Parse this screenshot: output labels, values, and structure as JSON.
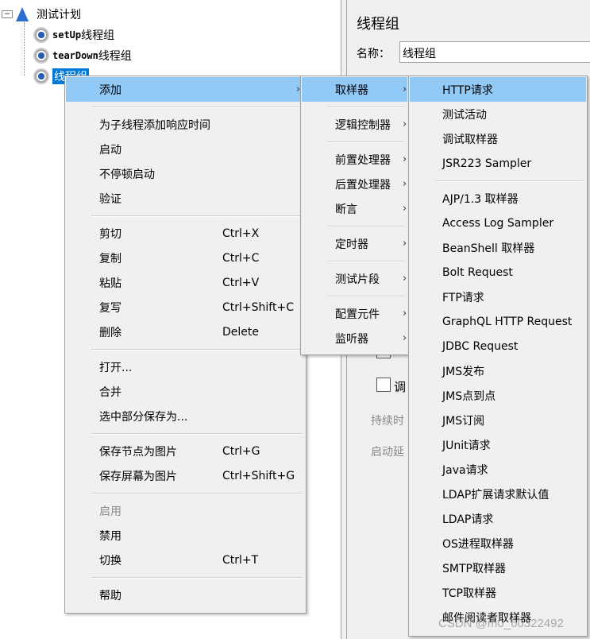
{
  "tree": {
    "root": "测试计划",
    "nodes": [
      {
        "prefix": "setUp",
        "label": "线程组"
      },
      {
        "prefix": "tearDown",
        "label": "线程组"
      },
      {
        "prefix": "",
        "label": "线程组"
      }
    ]
  },
  "panel": {
    "title": "线程组",
    "name_label": "名称：",
    "name_value": "线程组",
    "scheduler_label": "调",
    "duration_label": "持续时",
    "delay_label": "启动延"
  },
  "menu1": [
    {
      "label": "添加",
      "arrow": true,
      "hl": true
    },
    "sep",
    {
      "label": "为子线程添加响应时间"
    },
    {
      "label": "启动"
    },
    {
      "label": "不停顿启动"
    },
    {
      "label": "验证"
    },
    "sep",
    {
      "label": "剪切",
      "shortcut": "Ctrl+X"
    },
    {
      "label": "复制",
      "shortcut": "Ctrl+C"
    },
    {
      "label": "粘贴",
      "shortcut": "Ctrl+V"
    },
    {
      "label": "复写",
      "shortcut": "Ctrl+Shift+C"
    },
    {
      "label": "删除",
      "shortcut": "Delete"
    },
    "sep",
    {
      "label": "打开..."
    },
    {
      "label": "合并"
    },
    {
      "label": "选中部分保存为..."
    },
    "sep",
    {
      "label": "保存节点为图片",
      "shortcut": "Ctrl+G"
    },
    {
      "label": "保存屏幕为图片",
      "shortcut": "Ctrl+Shift+G"
    },
    "sep",
    {
      "label": "启用",
      "disabled": true
    },
    {
      "label": "禁用"
    },
    {
      "label": "切换",
      "shortcut": "Ctrl+T"
    },
    "sep",
    {
      "label": "帮助"
    }
  ],
  "menu2": [
    {
      "label": "取样器",
      "arrow": true,
      "hl": true
    },
    "sep",
    {
      "label": "逻辑控制器",
      "arrow": true
    },
    "sep",
    {
      "label": "前置处理器",
      "arrow": true
    },
    {
      "label": "后置处理器",
      "arrow": true
    },
    {
      "label": "断言",
      "arrow": true
    },
    "sep",
    {
      "label": "定时器",
      "arrow": true
    },
    "sep",
    {
      "label": "测试片段",
      "arrow": true
    },
    "sep",
    {
      "label": "配置元件",
      "arrow": true
    },
    {
      "label": "监听器",
      "arrow": true
    }
  ],
  "menu3": [
    {
      "label": "HTTP请求",
      "hl": true
    },
    {
      "label": "测试活动"
    },
    {
      "label": "调试取样器"
    },
    {
      "label": "JSR223 Sampler"
    },
    "sep",
    {
      "label": "AJP/1.3 取样器"
    },
    {
      "label": "Access Log Sampler"
    },
    {
      "label": "BeanShell 取样器"
    },
    {
      "label": "Bolt Request"
    },
    {
      "label": "FTP请求"
    },
    {
      "label": "GraphQL HTTP Request"
    },
    {
      "label": "JDBC Request"
    },
    {
      "label": "JMS发布"
    },
    {
      "label": "JMS点到点"
    },
    {
      "label": "JMS订阅"
    },
    {
      "label": "JUnit请求"
    },
    {
      "label": "Java请求"
    },
    {
      "label": "LDAP扩展请求默认值"
    },
    {
      "label": "LDAP请求"
    },
    {
      "label": "OS进程取样器"
    },
    {
      "label": "SMTP取样器"
    },
    {
      "label": "TCP取样器"
    },
    {
      "label": "邮件阅读者取样器"
    }
  ],
  "watermark": "CSDN @m0_60322492"
}
